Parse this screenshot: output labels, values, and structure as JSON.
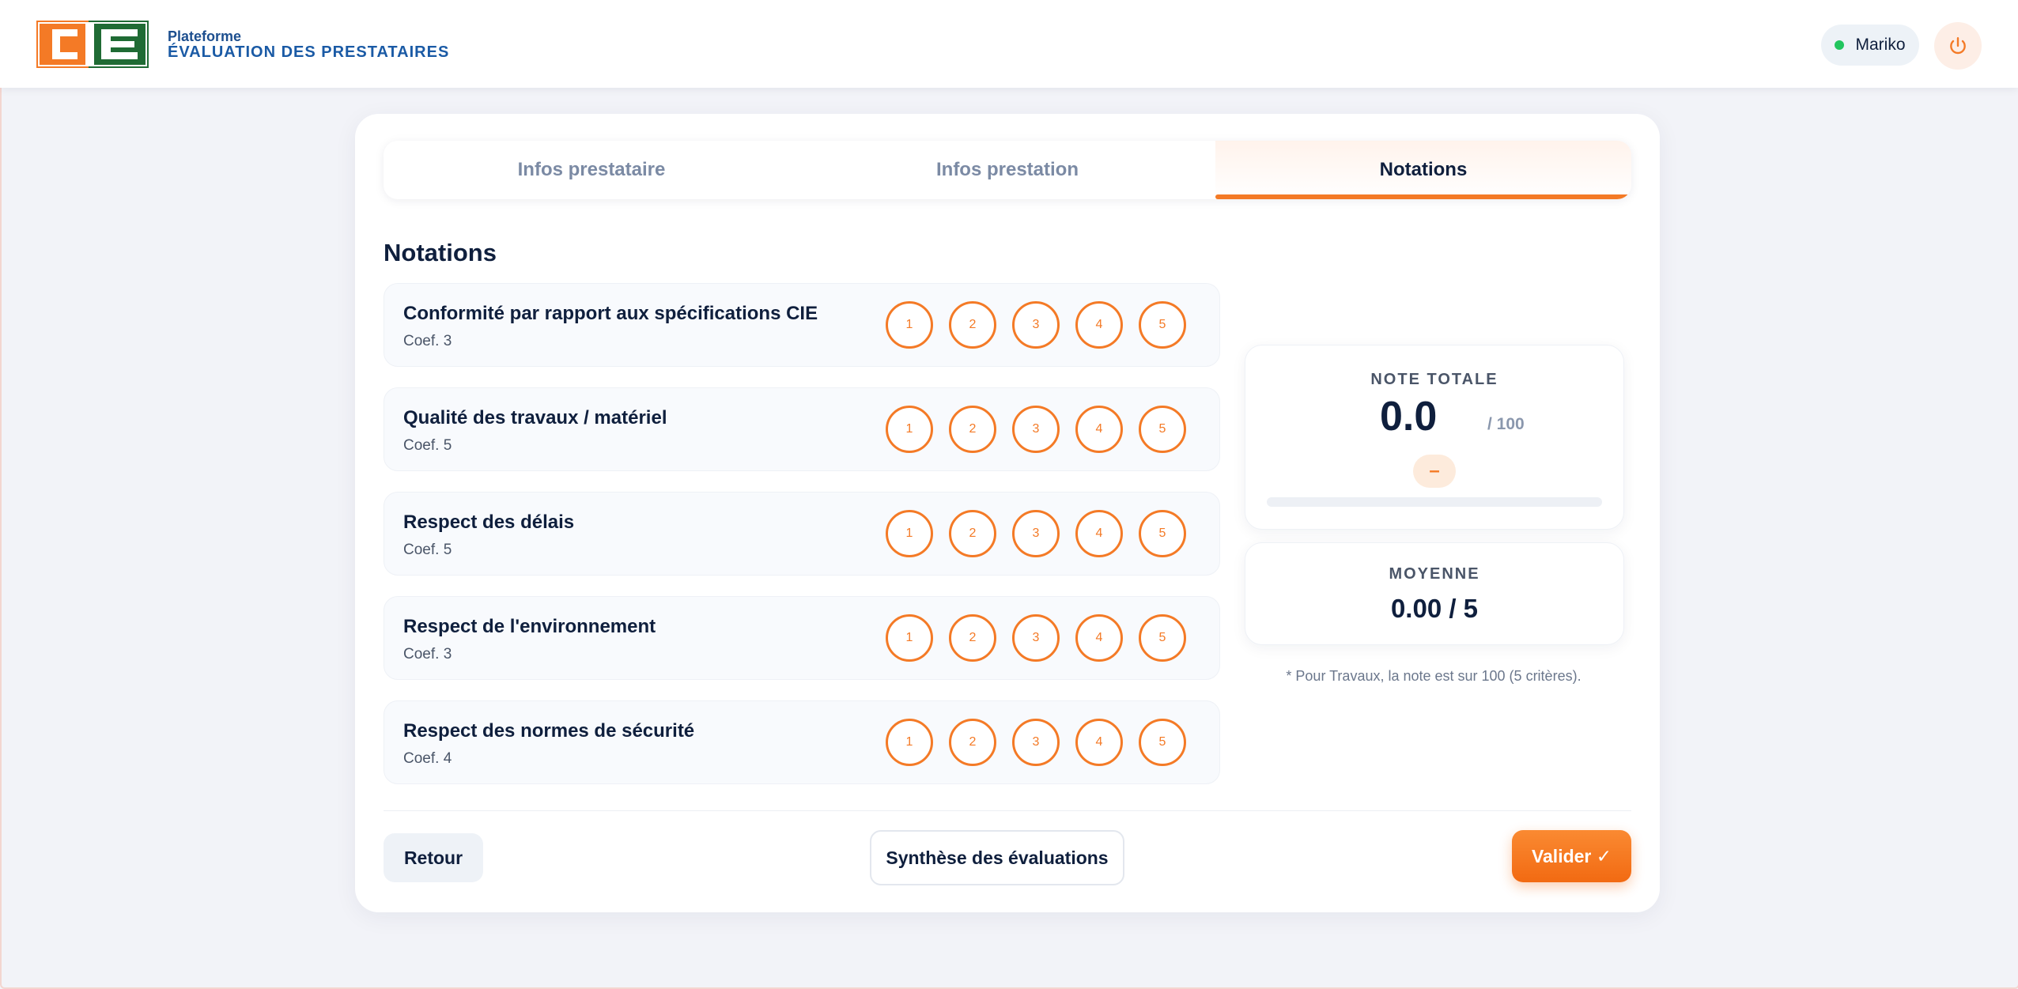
{
  "header": {
    "logo_text": "CIE",
    "brand_small": "Plateforme",
    "brand_title": "ÉVALUATION DES PRESTATAIRES",
    "user": {
      "name": "Mariko",
      "status": "online",
      "status_color": "#22c55e"
    },
    "logout_icon": "power-icon"
  },
  "tabs": [
    {
      "label": "Infos prestataire",
      "active": false
    },
    {
      "label": "Infos prestation",
      "active": false
    },
    {
      "label": "Notations",
      "active": true
    }
  ],
  "section": {
    "title": "Notations"
  },
  "criteria": [
    {
      "name": "Conformité par rapport aux spécifications CIE",
      "coef": "Coef. 3"
    },
    {
      "name": "Qualité des travaux / matériel",
      "coef": "Coef. 5"
    },
    {
      "name": "Respect des délais",
      "coef": "Coef. 5"
    },
    {
      "name": "Respect de l'environnement",
      "coef": "Coef. 3"
    },
    {
      "name": "Respect des normes de sécurité",
      "coef": "Coef. 4"
    }
  ],
  "rating_options": [
    "1",
    "2",
    "3",
    "4",
    "5"
  ],
  "summary": {
    "total_label": "NOTE TOTALE",
    "total_value": "0.0",
    "total_max": "/ 100",
    "grade": "–",
    "progress_percent": 0,
    "average_label": "MOYENNE",
    "average_value": "0.00 / 5",
    "note": "* Pour Travaux, la note est sur 100 (5 critères)."
  },
  "footer": {
    "back_label": "Retour",
    "synthesis_label": "Synthèse des évaluations",
    "validate_label": "Valider ✓"
  },
  "colors": {
    "accent": "#f47a26",
    "brand_blue": "#1a5aa5",
    "brand_green": "#1f6b34",
    "text_dark": "#0f1f3d"
  }
}
